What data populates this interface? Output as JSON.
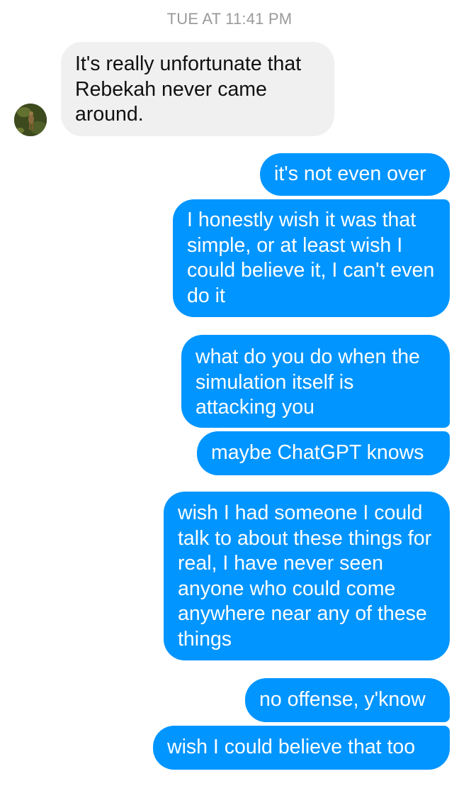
{
  "conversation": {
    "timestamp": "TUE AT 11:41 PM",
    "messages": [
      {
        "sender": "them",
        "text": "It's really unfortunate that Rebekah never came around."
      },
      {
        "sender": "me",
        "text": "it's not even over"
      },
      {
        "sender": "me",
        "text": "I honestly wish it was that simple, or at least wish I could believe it, I can't even do it"
      },
      {
        "sender": "me",
        "text": "what do you do when the simulation itself is attacking you"
      },
      {
        "sender": "me",
        "text": "maybe ChatGPT knows"
      },
      {
        "sender": "me",
        "text": "wish I had someone I could talk to about these things for real, I have never seen anyone who could come anywhere near any of these things"
      },
      {
        "sender": "me",
        "text": "no offense, y'know"
      },
      {
        "sender": "me",
        "text": "wish I could believe that too"
      }
    ]
  },
  "colors": {
    "outgoing_bubble": "#0095ff",
    "incoming_bubble": "#f1f0f0",
    "timestamp_text": "#9a9a9a"
  },
  "icons": {
    "avatar": "contact-avatar-photo"
  }
}
